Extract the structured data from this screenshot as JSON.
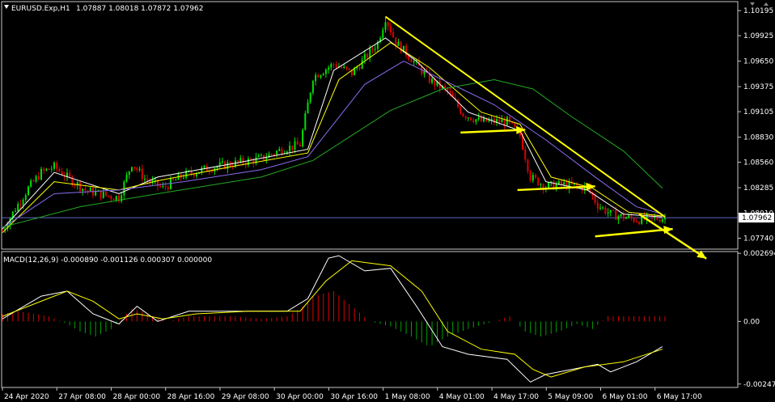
{
  "header": {
    "symbol_label": "EURUSD.Exp,H1",
    "ohlc_label": "1.07887 1.08018 1.07872 1.07962",
    "menu_icon": "triangle-down-icon"
  },
  "colors": {
    "background": "#000000",
    "bull": "#00e000",
    "bear": "#e00000",
    "ma_fast": "#ffffff",
    "ma_mid": "#ffff00",
    "ma_slow": "#8a6cf0",
    "ma_long": "#22aa22",
    "trend": "#ffff00",
    "price_line": "#7a8cff",
    "macd_hist_pos": "#e00000",
    "macd_hist_neg": "#00a000",
    "macd_line": "#ffffff",
    "signal_line": "#ffff00"
  },
  "chart_data": [
    {
      "type": "candlestick",
      "title": "EURUSD.Exp,H1",
      "current_price": "1.07962",
      "y_ticks": [
        "1.10195",
        "1.09925",
        "1.09650",
        "1.09375",
        "1.09105",
        "1.08830",
        "1.08560",
        "1.08285",
        "1.08010",
        "1.07740"
      ],
      "ylim": [
        1.0764,
        1.1024
      ],
      "x_ticks": [
        "24 Apr 2020",
        "27 Apr 08:00",
        "28 Apr 00:00",
        "28 Apr 16:00",
        "29 Apr 08:00",
        "30 Apr 00:00",
        "30 Apr 16:00",
        "1 May 08:00",
        "4 May 01:00",
        "4 May 17:00",
        "5 May 09:00",
        "6 May 01:00",
        "6 May 17:00"
      ],
      "price_path": [
        {
          "t": 0,
          "p": 1.0782
        },
        {
          "t": 5,
          "p": 1.0806
        },
        {
          "t": 10,
          "p": 1.0828
        },
        {
          "t": 15,
          "p": 1.0845
        },
        {
          "t": 20,
          "p": 1.0851
        },
        {
          "t": 25,
          "p": 1.084
        },
        {
          "t": 32,
          "p": 1.0826
        },
        {
          "t": 40,
          "p": 1.082
        },
        {
          "t": 45,
          "p": 1.0818
        },
        {
          "t": 50,
          "p": 1.0855
        },
        {
          "t": 55,
          "p": 1.0838
        },
        {
          "t": 62,
          "p": 1.0828
        },
        {
          "t": 70,
          "p": 1.0842
        },
        {
          "t": 80,
          "p": 1.085
        },
        {
          "t": 90,
          "p": 1.0855
        },
        {
          "t": 100,
          "p": 1.086
        },
        {
          "t": 108,
          "p": 1.087
        },
        {
          "t": 115,
          "p": 1.0875
        },
        {
          "t": 120,
          "p": 1.0948
        },
        {
          "t": 128,
          "p": 1.0962
        },
        {
          "t": 135,
          "p": 1.0952
        },
        {
          "t": 140,
          "p": 1.0968
        },
        {
          "t": 145,
          "p": 1.0985
        },
        {
          "t": 148,
          "p": 1.1012
        },
        {
          "t": 152,
          "p": 1.0985
        },
        {
          "t": 158,
          "p": 1.0968
        },
        {
          "t": 165,
          "p": 1.0945
        },
        {
          "t": 172,
          "p": 1.0932
        },
        {
          "t": 178,
          "p": 1.0908
        },
        {
          "t": 185,
          "p": 1.09
        },
        {
          "t": 195,
          "p": 1.09
        },
        {
          "t": 200,
          "p": 1.0885
        },
        {
          "t": 204,
          "p": 1.084
        },
        {
          "t": 210,
          "p": 1.083
        },
        {
          "t": 216,
          "p": 1.0832
        },
        {
          "t": 222,
          "p": 1.083
        },
        {
          "t": 226,
          "p": 1.0828
        },
        {
          "t": 230,
          "p": 1.081
        },
        {
          "t": 235,
          "p": 1.08
        },
        {
          "t": 245,
          "p": 1.0794
        },
        {
          "t": 255,
          "p": 1.0796
        }
      ],
      "moving_averages": [
        {
          "name": "",
          "color": "#ffffff",
          "points": [
            [
              0,
              1.0784
            ],
            [
              20,
              1.0845
            ],
            [
              45,
              1.0822
            ],
            [
              60,
              1.084
            ],
            [
              90,
              1.0855
            ],
            [
              118,
              1.087
            ],
            [
              128,
              1.0955
            ],
            [
              148,
              1.099
            ],
            [
              160,
              1.0965
            ],
            [
              180,
              1.091
            ],
            [
              200,
              1.089
            ],
            [
              210,
              1.0835
            ],
            [
              226,
              1.0826
            ],
            [
              240,
              1.08
            ],
            [
              255,
              1.0797
            ]
          ]
        },
        {
          "name": "",
          "color": "#ffff00",
          "points": [
            [
              0,
              1.078
            ],
            [
              20,
              1.0835
            ],
            [
              45,
              1.0826
            ],
            [
              60,
              1.0836
            ],
            [
              90,
              1.0852
            ],
            [
              118,
              1.0866
            ],
            [
              130,
              1.0945
            ],
            [
              150,
              1.0985
            ],
            [
              165,
              1.0958
            ],
            [
              185,
              1.091
            ],
            [
              200,
              1.0897
            ],
            [
              212,
              1.084
            ],
            [
              228,
              1.0828
            ],
            [
              242,
              1.0802
            ],
            [
              255,
              1.0798
            ]
          ]
        },
        {
          "name": "",
          "color": "#8a6cf0",
          "points": [
            [
              0,
              1.0785
            ],
            [
              20,
              1.0822
            ],
            [
              45,
              1.0826
            ],
            [
              70,
              1.0835
            ],
            [
              100,
              1.0848
            ],
            [
              118,
              1.0862
            ],
            [
              140,
              1.094
            ],
            [
              155,
              1.0965
            ],
            [
              170,
              1.0945
            ],
            [
              190,
              1.0918
            ],
            [
              210,
              1.088
            ],
            [
              230,
              1.0838
            ],
            [
              245,
              1.0808
            ],
            [
              255,
              1.08
            ]
          ]
        },
        {
          "name": "",
          "color": "#22aa22",
          "points": [
            [
              0,
              1.0786
            ],
            [
              30,
              1.0808
            ],
            [
              60,
              1.0822
            ],
            [
              100,
              1.084
            ],
            [
              120,
              1.0858
            ],
            [
              150,
              1.0912
            ],
            [
              170,
              1.0935
            ],
            [
              190,
              1.0945
            ],
            [
              205,
              1.0935
            ],
            [
              220,
              1.0905
            ],
            [
              240,
              1.0868
            ],
            [
              255,
              1.0828
            ]
          ]
        }
      ],
      "trendlines": [
        {
          "kind": "line",
          "from": [
            148,
            1.1013
          ],
          "to": [
            256,
            1.0797
          ]
        },
        {
          "kind": "arrow",
          "from": [
            177,
            1.0888
          ],
          "to": [
            202,
            1.0891
          ]
        },
        {
          "kind": "arrow",
          "from": [
            199,
            1.0826
          ],
          "to": [
            229,
            1.083
          ]
        },
        {
          "kind": "arrow",
          "from": [
            229,
            1.0776
          ],
          "to": [
            259,
            1.0784
          ]
        },
        {
          "kind": "arrow",
          "from": [
            246,
            1.08
          ],
          "to": [
            272,
            1.0752
          ]
        }
      ]
    },
    {
      "type": "macd",
      "title": "MACD(12,26,9) -0.000890 -0.001126 0.000307 0.000000",
      "y_ticks": [
        "0.002694",
        "0.00",
        "-0.002479"
      ],
      "ylim": [
        -0.00255,
        0.0027
      ],
      "histogram": [
        [
          0,
          0.0003
        ],
        [
          6,
          0.0004
        ],
        [
          12,
          0.0003
        ],
        [
          18,
          0.0002
        ],
        [
          25,
          -0.0001
        ],
        [
          30,
          -0.0004
        ],
        [
          36,
          -0.0006
        ],
        [
          42,
          -0.0003
        ],
        [
          46,
          0.0001
        ],
        [
          50,
          0.0005
        ],
        [
          54,
          0.0004
        ],
        [
          58,
          0.0002
        ],
        [
          64,
          0.0
        ],
        [
          72,
          0.0002
        ],
        [
          80,
          0.0002
        ],
        [
          90,
          0.0002
        ],
        [
          100,
          0.0001
        ],
        [
          110,
          0.0002
        ],
        [
          115,
          0.0005
        ],
        [
          120,
          0.001
        ],
        [
          128,
          0.0012
        ],
        [
          135,
          0.0006
        ],
        [
          142,
          0.0
        ],
        [
          150,
          -0.0002
        ],
        [
          158,
          -0.0006
        ],
        [
          165,
          -0.001
        ],
        [
          172,
          -0.0006
        ],
        [
          180,
          -0.0003
        ],
        [
          190,
          0.0
        ],
        [
          196,
          0.0002
        ],
        [
          202,
          -0.0004
        ],
        [
          208,
          -0.0006
        ],
        [
          215,
          -0.0004
        ],
        [
          222,
          -0.0001
        ],
        [
          228,
          -0.0003
        ],
        [
          234,
          0.0002
        ],
        [
          244,
          0.0002
        ],
        [
          255,
          0.0002
        ]
      ],
      "macd_line": [
        [
          0,
          0.0001
        ],
        [
          15,
          0.001
        ],
        [
          25,
          0.0012
        ],
        [
          35,
          0.0003
        ],
        [
          45,
          -0.0001
        ],
        [
          52,
          0.0006
        ],
        [
          60,
          0.0
        ],
        [
          72,
          0.0004
        ],
        [
          90,
          0.0004
        ],
        [
          110,
          0.0004
        ],
        [
          118,
          0.0009
        ],
        [
          126,
          0.0025
        ],
        [
          130,
          0.0026
        ],
        [
          140,
          0.002
        ],
        [
          150,
          0.0021
        ],
        [
          160,
          0.0006
        ],
        [
          170,
          -0.001
        ],
        [
          180,
          -0.0013
        ],
        [
          195,
          -0.0015
        ],
        [
          204,
          -0.0024
        ],
        [
          210,
          -0.0021
        ],
        [
          220,
          -0.0019
        ],
        [
          230,
          -0.0017
        ],
        [
          235,
          -0.002
        ],
        [
          245,
          -0.0016
        ],
        [
          255,
          -0.001
        ]
      ],
      "signal_line": [
        [
          0,
          0.0002
        ],
        [
          15,
          0.0008
        ],
        [
          25,
          0.0012
        ],
        [
          35,
          0.0008
        ],
        [
          45,
          0.0001
        ],
        [
          52,
          0.0003
        ],
        [
          62,
          0.0001
        ],
        [
          75,
          0.0003
        ],
        [
          95,
          0.0004
        ],
        [
          115,
          0.0004
        ],
        [
          125,
          0.0016
        ],
        [
          135,
          0.0024
        ],
        [
          150,
          0.0022
        ],
        [
          162,
          0.0012
        ],
        [
          172,
          -0.0004
        ],
        [
          185,
          -0.0011
        ],
        [
          198,
          -0.0013
        ],
        [
          205,
          -0.0019
        ],
        [
          212,
          -0.0022
        ],
        [
          225,
          -0.0018
        ],
        [
          240,
          -0.0016
        ],
        [
          255,
          -0.0011
        ]
      ]
    }
  ]
}
